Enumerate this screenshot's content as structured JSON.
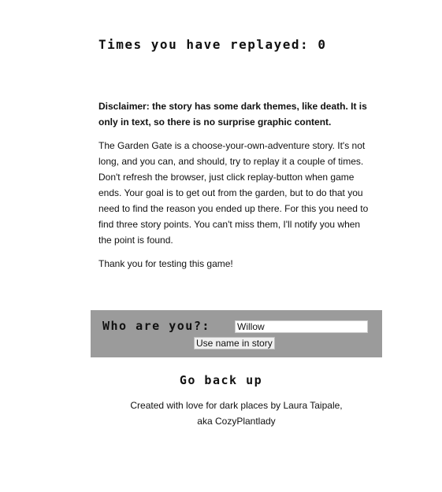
{
  "counter": {
    "label": "Times you have replayed: 0"
  },
  "intro": {
    "disclaimer": "Disclaimer: the story has some dark themes, like death. It is only in text, so there is no surprise graphic content.",
    "description": "The Garden Gate is a choose-your-own-adventure story. It's not long, and you can, and should, try to replay it a couple of times. Don't refresh the browser, just click replay-button when game ends. Your goal is to get out from the garden, but to do that you need to find the reason you ended up there. For this you need to find three story points. You can't miss them, I'll notify you when the point is found.",
    "thanks": "Thank you for testing this game!"
  },
  "name_form": {
    "label": "Who are you?:",
    "value": "Willow",
    "button_label": "Use name in story",
    "background": "#9b9b9b"
  },
  "footer": {
    "go_back_label": "Go back up",
    "credit_line_1": "Created with love for dark places by Laura Taipale,",
    "credit_line_2": "aka CozyPlantlady"
  }
}
